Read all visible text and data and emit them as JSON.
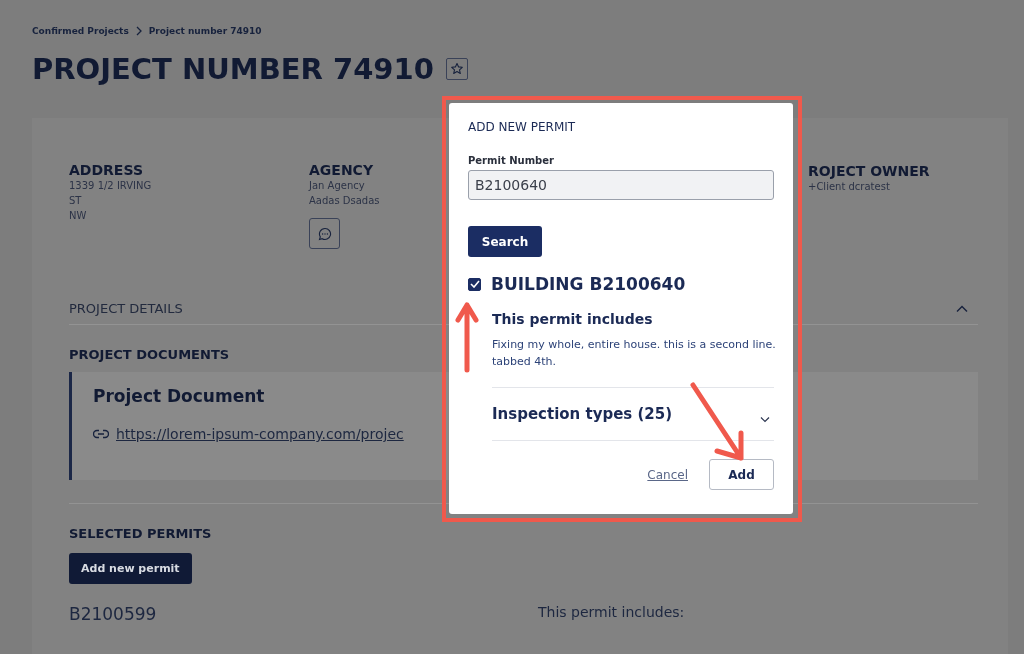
{
  "breadcrumb": [
    {
      "label": "Confirmed Projects"
    },
    {
      "label": "Project number 74910"
    }
  ],
  "title": "PROJECT NUMBER 74910",
  "info": [
    {
      "heading": "ADDRESS",
      "lines": [
        "1339 1/2 IRVING",
        "ST",
        "NW"
      ]
    },
    {
      "heading": "AGENCY",
      "lines": [
        "Jan Agency",
        "Aadas Dsadas"
      ],
      "chat_button": true
    }
  ],
  "owner": {
    "heading": "ROJECT OWNER",
    "line": "+Client dcratest"
  },
  "project_details": {
    "label": "PROJECT DETAILS",
    "expanded": true
  },
  "documents": {
    "heading": "PROJECT DOCUMENTS",
    "items": [
      {
        "title": "Project Document",
        "link": "https://lorem-ipsum-company.com/projec"
      }
    ]
  },
  "permits": {
    "heading": "SELECTED PERMITS",
    "add_button": "Add new permit",
    "items": [
      {
        "number": "B2100599",
        "includes": "This permit includes:"
      }
    ]
  },
  "modal": {
    "title": "ADD NEW PERMIT",
    "field_label": "Permit Number",
    "field_value": "B2100640",
    "search_button": "Search",
    "result": {
      "checked": true,
      "title": "BUILDING B2100640",
      "includes_heading": "This permit includes",
      "description": "Fixing my whole, entire house. this is a second line. tabbed 4th.",
      "accordion": {
        "label": "Inspection types (25)",
        "expanded": false
      }
    },
    "cancel": "Cancel",
    "add": "Add"
  }
}
